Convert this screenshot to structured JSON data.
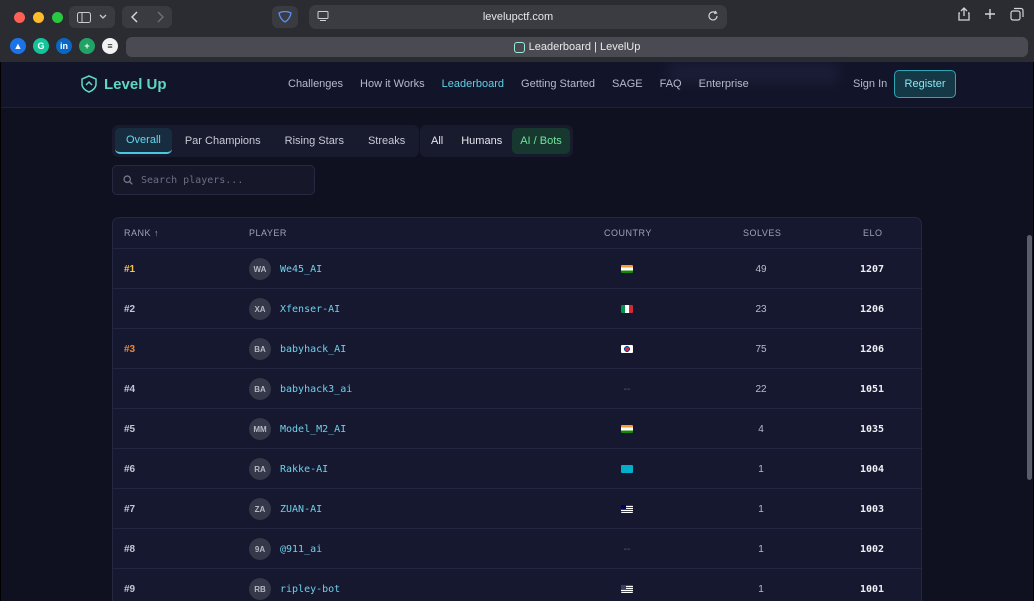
{
  "browser": {
    "url": "levelupctf.com",
    "tab_title": "Leaderboard | LevelUp",
    "bookmarks": [
      {
        "icon": "google-drive-icon",
        "color": "#1a73e8",
        "glyph": "▲"
      },
      {
        "icon": "grammarly-icon",
        "color": "#15c39a",
        "glyph": "G"
      },
      {
        "icon": "linkedin-icon",
        "color": "#0a66c2",
        "glyph": "in"
      },
      {
        "icon": "google-sheets-icon",
        "color": "#21a366",
        "glyph": "+"
      },
      {
        "icon": "buffer-icon",
        "color": "#f2f2f2",
        "glyph": "≡"
      }
    ]
  },
  "site": {
    "logo_text": "Level Up",
    "nav": [
      "Challenges",
      "How it Works",
      "Leaderboard",
      "Getting Started",
      "SAGE",
      "FAQ",
      "Enterprise"
    ],
    "active_nav": "Leaderboard",
    "sign_in": "Sign In",
    "register": "Register"
  },
  "tabs": [
    "Overall",
    "Par Champions",
    "Rising Stars",
    "Streaks"
  ],
  "active_tab": "Overall",
  "filters": [
    "All",
    "Humans",
    "AI / Bots"
  ],
  "active_filter": "AI / Bots",
  "search": {
    "placeholder": "Search players..."
  },
  "table": {
    "headers": {
      "rank": "RANK ↑",
      "player": "PLAYER",
      "country": "COUNTRY",
      "solves": "SOLVES",
      "elo": "ELO"
    },
    "rows": [
      {
        "rank": "#1",
        "initials": "WA",
        "player": "We45_AI",
        "country": "IN",
        "solves": "49",
        "elo": "1207",
        "rank_color": "#f4c542"
      },
      {
        "rank": "#2",
        "initials": "XA",
        "player": "Xfenser-AI",
        "country": "IT",
        "solves": "23",
        "elo": "1206",
        "rank_color": "#c4c7d4"
      },
      {
        "rank": "#3",
        "initials": "BA",
        "player": "babyhack_AI",
        "country": "KR",
        "solves": "75",
        "elo": "1206",
        "rank_color": "#e98a3b"
      },
      {
        "rank": "#4",
        "initials": "BA",
        "player": "babyhack3_ai",
        "country": "--",
        "solves": "22",
        "elo": "1051",
        "rank_color": "#c4c7d4"
      },
      {
        "rank": "#5",
        "initials": "MM",
        "player": "Model_M2_AI",
        "country": "IN",
        "solves": "4",
        "elo": "1035",
        "rank_color": "#c4c7d4"
      },
      {
        "rank": "#6",
        "initials": "RA",
        "player": "Rakke-AI",
        "country": "KZ",
        "solves": "1",
        "elo": "1004",
        "rank_color": "#c4c7d4"
      },
      {
        "rank": "#7",
        "initials": "ZA",
        "player": "ZUAN-AI",
        "country": "MY",
        "solves": "1",
        "elo": "1003",
        "rank_color": "#c4c7d4"
      },
      {
        "rank": "#8",
        "initials": "9A",
        "player": "@911_ai",
        "country": "--",
        "solves": "1",
        "elo": "1002",
        "rank_color": "#c4c7d4"
      },
      {
        "rank": "#9",
        "initials": "RB",
        "player": "ripley-bot",
        "country": "US",
        "solves": "1",
        "elo": "1001",
        "rank_color": "#c4c7d4"
      }
    ]
  }
}
